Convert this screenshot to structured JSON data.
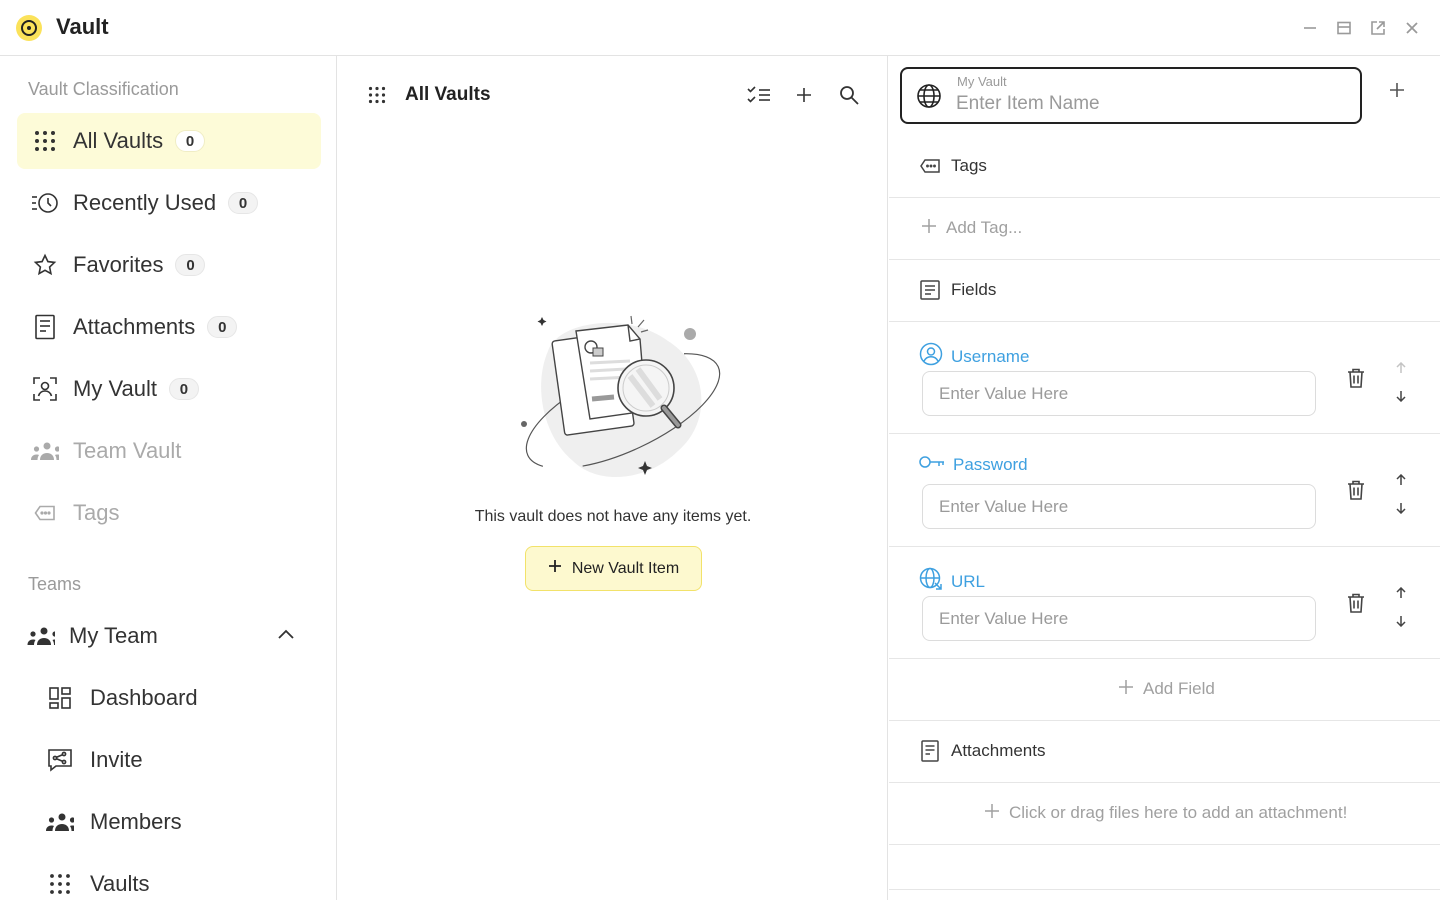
{
  "app": {
    "title": "Vault"
  },
  "sidebar": {
    "classification_label": "Vault Classification",
    "items": [
      {
        "label": "All Vaults",
        "count": "0",
        "icon": "grid-dots-icon"
      },
      {
        "label": "Recently Used",
        "count": "0",
        "icon": "recent-clock-icon"
      },
      {
        "label": "Favorites",
        "count": "0",
        "icon": "star-icon"
      },
      {
        "label": "Attachments",
        "count": "0",
        "icon": "document-icon"
      },
      {
        "label": "My Vault",
        "count": "0",
        "icon": "user-scan-icon"
      },
      {
        "label": "Team Vault",
        "icon": "team-icon"
      },
      {
        "label": "Tags",
        "icon": "tag-icon"
      }
    ],
    "teams_label": "Teams",
    "team": {
      "name": "My Team",
      "sub_items": [
        {
          "label": "Dashboard",
          "icon": "dashboard-icon"
        },
        {
          "label": "Invite",
          "icon": "share-icon"
        },
        {
          "label": "Members",
          "icon": "members-icon"
        },
        {
          "label": "Vaults",
          "icon": "grid-dots-icon"
        }
      ]
    }
  },
  "middle": {
    "title": "All Vaults",
    "empty_text": "This vault does not have any items yet.",
    "new_button": "New Vault Item"
  },
  "editor": {
    "vault_label": "My Vault",
    "name_placeholder": "Enter Item Name",
    "tags_label": "Tags",
    "add_tag": "Add Tag...",
    "fields_label": "Fields",
    "fields": [
      {
        "label": "Username",
        "placeholder": "Enter Value Here",
        "icon": "user-circle-icon"
      },
      {
        "label": "Password",
        "placeholder": "Enter Value Here",
        "icon": "key-icon"
      },
      {
        "label": "URL",
        "placeholder": "Enter Value Here",
        "icon": "globe-link-icon"
      }
    ],
    "add_field": "Add Field",
    "attachments_label": "Attachments",
    "attachment_hint": "Click or drag files here to add an attachment!"
  },
  "colors": {
    "accent_yellow": "#fbe25a",
    "active_bg": "#fdfbd8",
    "field_blue": "#3ea0e0"
  }
}
